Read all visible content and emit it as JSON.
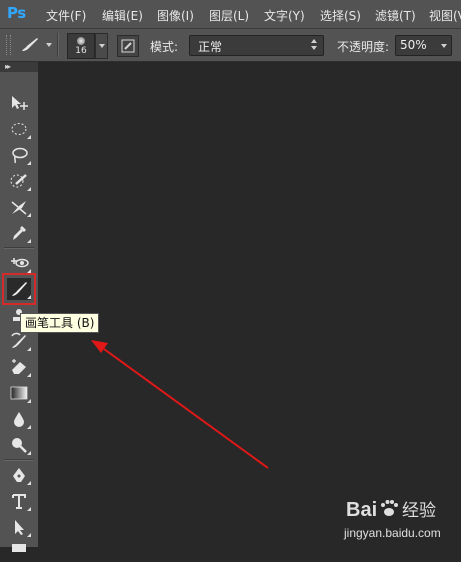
{
  "app": {
    "logo": "Ps"
  },
  "menu": [
    {
      "label": "文件(F)"
    },
    {
      "label": "编辑(E)"
    },
    {
      "label": "图像(I)"
    },
    {
      "label": "图层(L)"
    },
    {
      "label": "文字(Y)"
    },
    {
      "label": "选择(S)"
    },
    {
      "label": "滤镜(T)"
    },
    {
      "label": "视图(V)"
    }
  ],
  "options": {
    "brush_size": "16",
    "mode_label": "模式:",
    "mode_value": "正常",
    "opacity_label": "不透明度:",
    "opacity_value": "50%"
  },
  "tooltip": {
    "text": "画笔工具 (B)"
  },
  "watermark": {
    "brand": "Bai",
    "brand_suffix": "经验",
    "url": "jingyan.baidu.com"
  },
  "colors": {
    "highlight": "#d42a2a",
    "arrow": "#e01818",
    "tooltip_bg": "#ffffe1"
  }
}
